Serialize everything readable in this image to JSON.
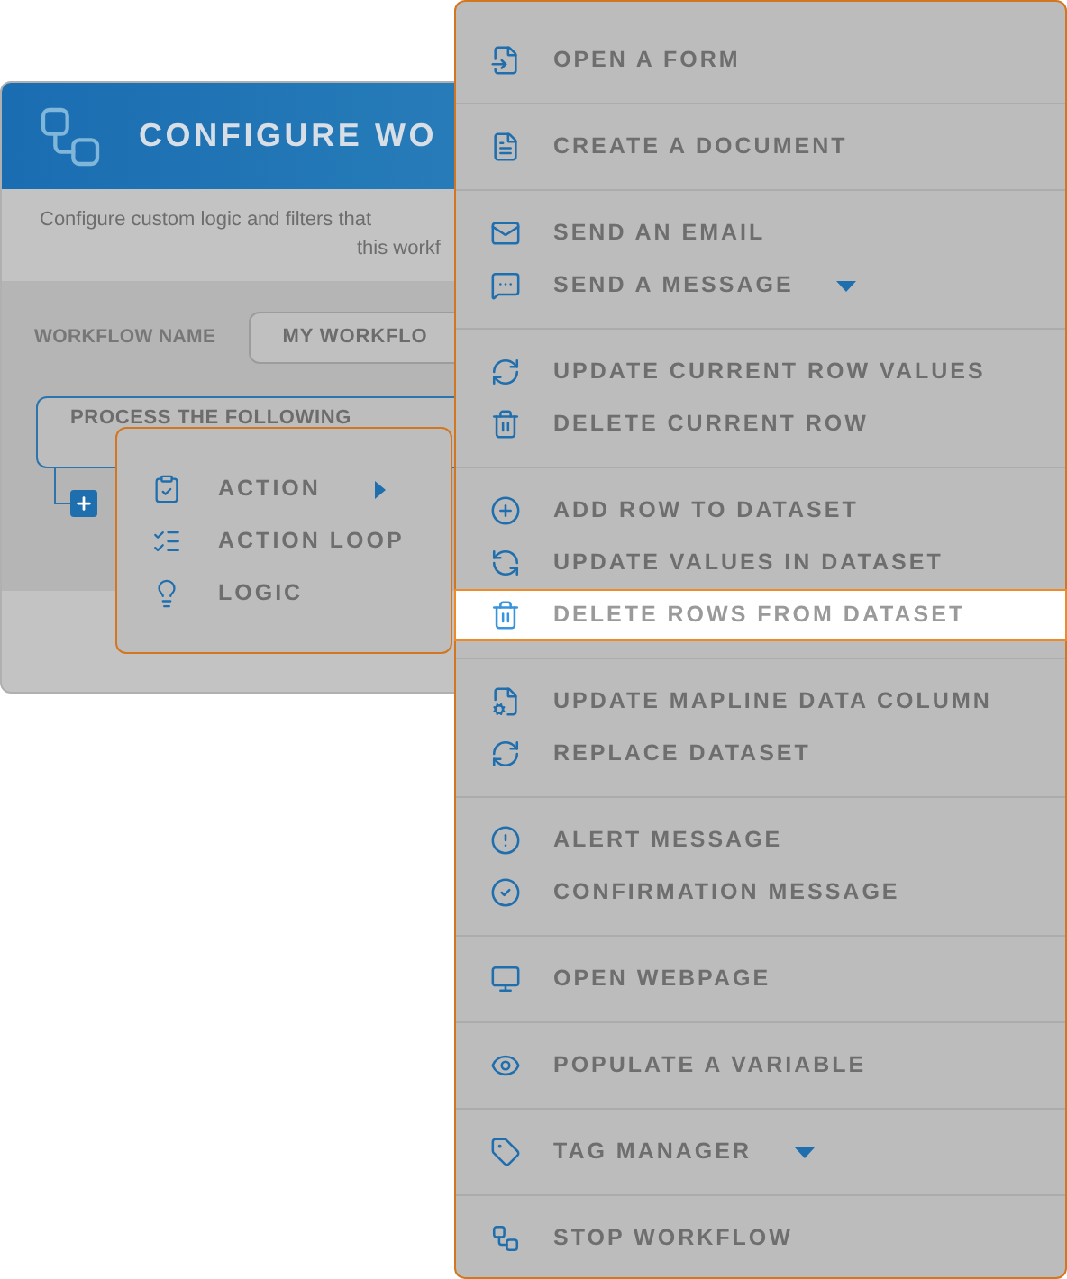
{
  "dialog": {
    "title": "CONFIGURE WO",
    "subtitle_lines": [
      "Configure custom logic and filters that",
      "this workf"
    ],
    "workflow_name": {
      "label": "WORKFLOW NAME",
      "value": "MY WORKFLO"
    },
    "process_box": "PROCESS THE FOLLOWING"
  },
  "popup": {
    "items": [
      {
        "label": "ACTION",
        "submenu": true
      },
      {
        "label": "ACTION LOOP",
        "submenu": false
      },
      {
        "label": "LOGIC",
        "submenu": false
      }
    ]
  },
  "menu": {
    "groups": [
      {
        "items": [
          {
            "label": "OPEN A FORM",
            "selected": false,
            "dropdown": false
          }
        ]
      },
      {
        "items": [
          {
            "label": "CREATE A DOCUMENT",
            "selected": false,
            "dropdown": false
          }
        ]
      },
      {
        "items": [
          {
            "label": "SEND AN EMAIL",
            "selected": false,
            "dropdown": false
          },
          {
            "label": "SEND A MESSAGE",
            "selected": false,
            "dropdown": true
          }
        ]
      },
      {
        "items": [
          {
            "label": "UPDATE CURRENT ROW VALUES",
            "selected": false,
            "dropdown": false
          },
          {
            "label": "DELETE CURRENT ROW",
            "selected": false,
            "dropdown": false
          }
        ]
      },
      {
        "items": [
          {
            "label": "ADD ROW TO DATASET",
            "selected": false,
            "dropdown": false
          },
          {
            "label": "UPDATE VALUES IN DATASET",
            "selected": false,
            "dropdown": false
          },
          {
            "label": "DELETE ROWS FROM DATASET",
            "selected": true,
            "dropdown": false
          }
        ]
      },
      {
        "items": [
          {
            "label": "UPDATE MAPLINE DATA COLUMN",
            "selected": false,
            "dropdown": false
          },
          {
            "label": "REPLACE DATASET",
            "selected": false,
            "dropdown": false
          }
        ]
      },
      {
        "items": [
          {
            "label": "ALERT MESSAGE",
            "selected": false,
            "dropdown": false
          },
          {
            "label": "CONFIRMATION MESSAGE",
            "selected": false,
            "dropdown": false
          }
        ]
      },
      {
        "items": [
          {
            "label": "OPEN WEBPAGE",
            "selected": false,
            "dropdown": false
          }
        ]
      },
      {
        "items": [
          {
            "label": "POPULATE A VARIABLE",
            "selected": false,
            "dropdown": false
          }
        ]
      },
      {
        "items": [
          {
            "label": "TAG MANAGER",
            "selected": false,
            "dropdown": true
          }
        ]
      },
      {
        "items": [
          {
            "label": "STOP WORKFLOW",
            "selected": false,
            "dropdown": false
          }
        ]
      }
    ]
  }
}
